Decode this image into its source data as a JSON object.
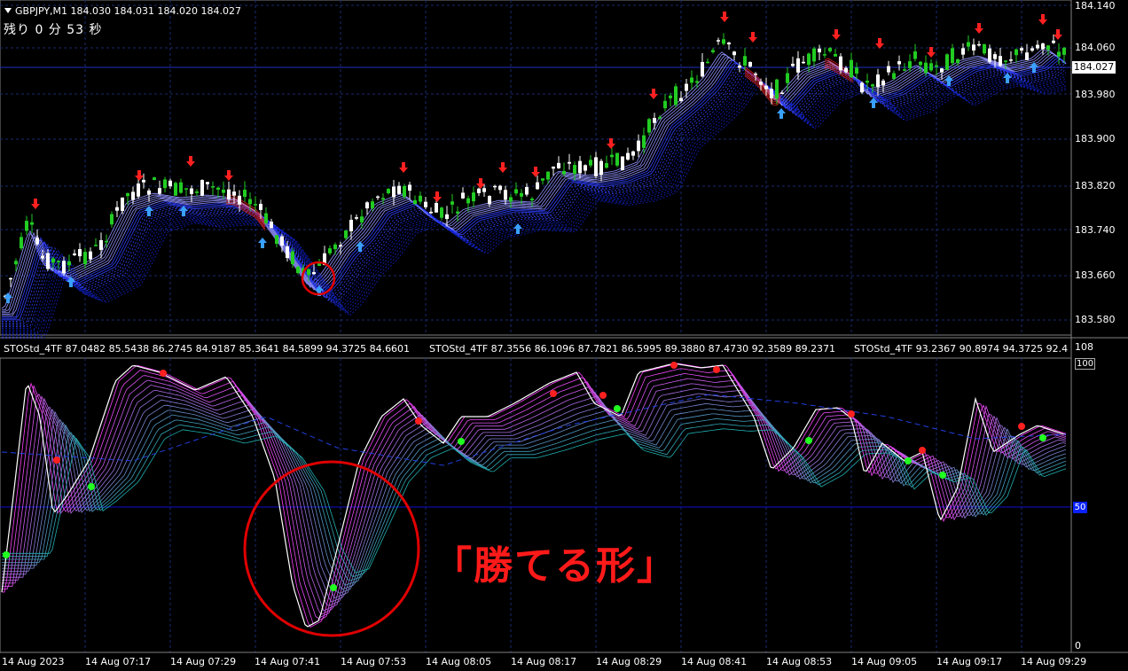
{
  "header": {
    "title": "GBPJPY,M1  184.030 184.031 184.020 184.027",
    "timer": "残り 0 分 53 秒"
  },
  "price_axis": {
    "ticks": [
      "184.140",
      "184.060",
      "183.980",
      "183.900",
      "183.820",
      "183.740",
      "183.660",
      "183.580"
    ],
    "current_price": "184.027"
  },
  "indicator": {
    "labels": [
      "STOStd_4TF 87.0482 85.5438 86.2745 84.9187 85.3641 84.5899 94.3725 84.6601",
      "STOStd_4TF 87.3556 86.1096 87.7821 86.5995 89.3880 87.4730 92.3589 89.2371",
      "STOStd_4TF 93.2367 90.8974 94.3725 92.4"
    ],
    "axis_top": "108",
    "axis_100": "100",
    "axis_50": "50",
    "axis_0": "0"
  },
  "time_axis": [
    "14 Aug 2023",
    "14 Aug 07:17",
    "14 Aug 07:29",
    "14 Aug 07:41",
    "14 Aug 07:53",
    "14 Aug 08:05",
    "14 Aug 08:17",
    "14 Aug 08:29",
    "14 Aug 08:41",
    "14 Aug 08:53",
    "14 Aug 09:05",
    "14 Aug 09:17",
    "14 Aug 09:29"
  ],
  "annotation": "「勝てる形」",
  "colors": {
    "background": "#000000",
    "grid": "#1a2a6e",
    "bull": "#22cc22",
    "bear": "#ffffff",
    "sell_arrow": "#ff2020",
    "buy_arrow": "#3aa0ff",
    "highlight_circle": "#e00000",
    "osc_main": "#ffffff",
    "osc_fast": "#ff40ff",
    "osc_slow": "#20b0b0"
  }
}
